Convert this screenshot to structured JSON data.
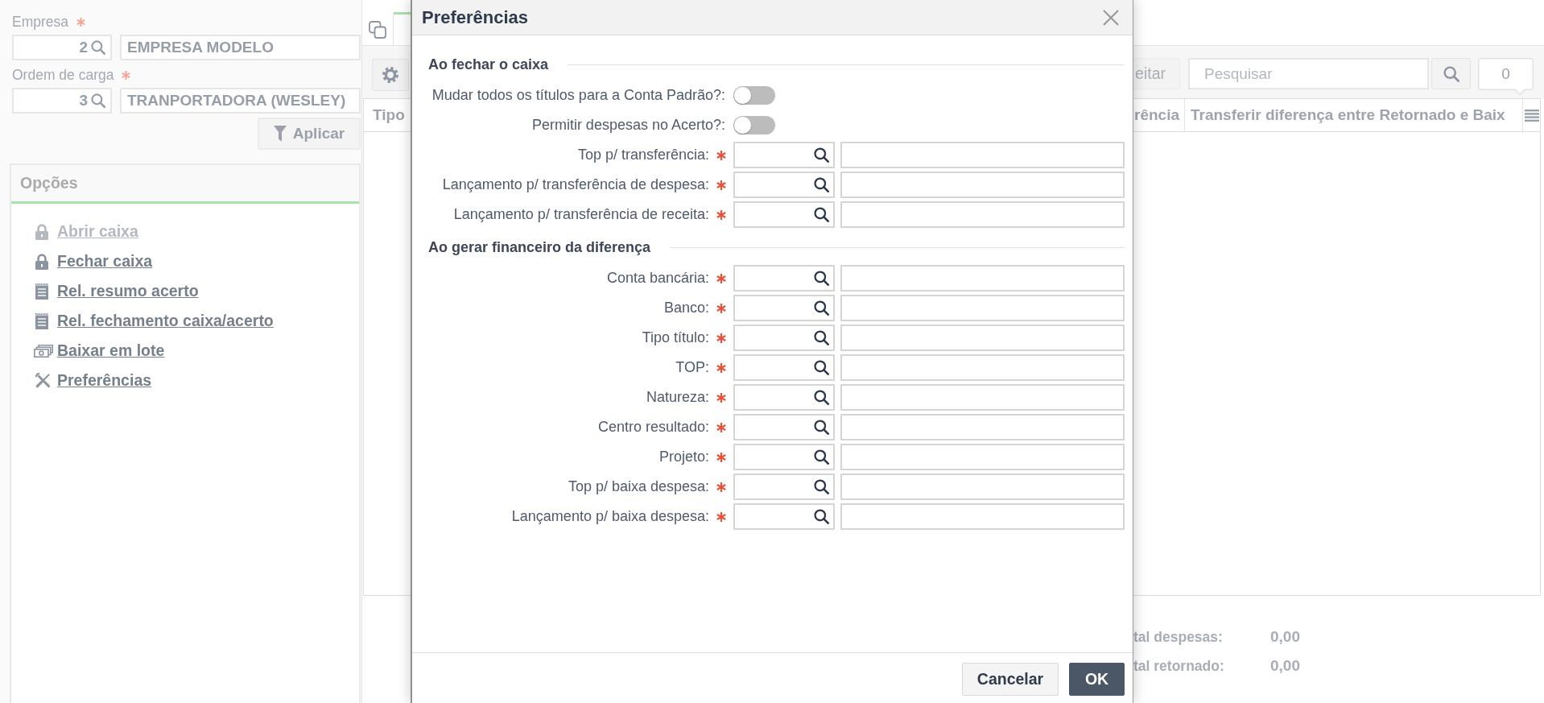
{
  "filters": {
    "fields": [
      {
        "label": "Empresa",
        "required": true,
        "code": "2",
        "name": "EMPRESA MODELO"
      },
      {
        "label": "Ordem de carga",
        "required": true,
        "code": "3",
        "name": "TRANPORTADORA (WESLEY)"
      }
    ],
    "apply_button": "Aplicar"
  },
  "options_panel": {
    "title": "Opções",
    "items": [
      {
        "kind": "lock",
        "label": "Abrir caixa",
        "disabled": true
      },
      {
        "kind": "lock",
        "label": "Fechar caixa",
        "disabled": false
      },
      {
        "kind": "report",
        "label": "Rel. resumo acerto",
        "disabled": false
      },
      {
        "kind": "report",
        "label": "Rel. fechamento caixa/acerto",
        "disabled": false
      },
      {
        "kind": "money",
        "label": "Baixar em lote",
        "disabled": false
      },
      {
        "kind": "tools",
        "label": "Preferências",
        "disabled": false
      }
    ]
  },
  "tabs": [
    {
      "selected": false
    },
    {
      "selected": true
    }
  ],
  "toolbar": {
    "button": "eitar",
    "search": {
      "placeholder": "Pesquisar"
    },
    "count": "0"
  },
  "grid": {
    "columns": [
      {
        "label": "Tipo"
      },
      {
        "label": "rência"
      },
      {
        "label": "Transferir diferença entre Retornado e Baix"
      }
    ]
  },
  "totals": [
    {
      "label": "tal despesas:",
      "value": "0,00"
    },
    {
      "label": "tal retornado:",
      "value": "0,00"
    }
  ],
  "dialog": {
    "title": "Preferências",
    "sections": [
      {
        "title": "Ao fechar o caixa",
        "rows": [
          {
            "kind": "toggle",
            "label": "Mudar todos os títulos para a Conta Padrão?:",
            "required": false,
            "on": false
          },
          {
            "kind": "toggle",
            "label": "Permitir despesas no Acerto?:",
            "required": false,
            "on": false
          },
          {
            "kind": "lookup",
            "label": "Top p/ transferência:",
            "required": true
          },
          {
            "kind": "lookup",
            "label": "Lançamento p/ transferência de despesa:",
            "required": true
          },
          {
            "kind": "lookup",
            "label": "Lançamento p/ transferência de receita:",
            "required": true
          }
        ]
      },
      {
        "title": "Ao gerar financeiro da diferença",
        "rows": [
          {
            "kind": "lookup",
            "label": "Conta bancária:",
            "required": true
          },
          {
            "kind": "lookup",
            "label": "Banco:",
            "required": true
          },
          {
            "kind": "lookup",
            "label": "Tipo título:",
            "required": true
          },
          {
            "kind": "lookup",
            "label": "TOP:",
            "required": true
          },
          {
            "kind": "lookup",
            "label": "Natureza:",
            "required": true
          },
          {
            "kind": "lookup",
            "label": "Centro resultado:",
            "required": true
          },
          {
            "kind": "lookup",
            "label": "Projeto:",
            "required": true
          },
          {
            "kind": "lookup",
            "label": "Top p/ baixa despesa:",
            "required": true
          },
          {
            "kind": "lookup",
            "label": "Lançamento p/ baixa despesa:",
            "required": true
          }
        ]
      }
    ],
    "buttons": [
      {
        "kind": "secondary",
        "label": "Cancelar"
      },
      {
        "kind": "primary",
        "label": "OK"
      }
    ]
  }
}
